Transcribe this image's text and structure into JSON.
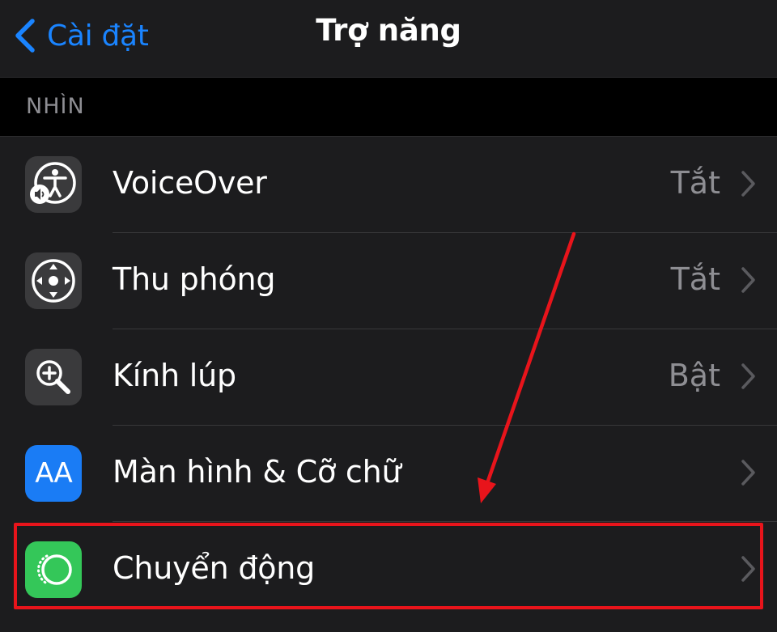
{
  "nav": {
    "back_label": "Cài đặt",
    "title": "Trợ năng"
  },
  "section": {
    "header": "NHÌN"
  },
  "rows": [
    {
      "label": "VoiceOver",
      "value": "Tắt",
      "icon": "voiceover-icon",
      "icon_bg": "#3a3a3c"
    },
    {
      "label": "Thu phóng",
      "value": "Tắt",
      "icon": "zoom-icon",
      "icon_bg": "#3a3a3c"
    },
    {
      "label": "Kính lúp",
      "value": "Bật",
      "icon": "magnifier-icon",
      "icon_bg": "#3a3a3c"
    },
    {
      "label": "Màn hình & Cỡ chữ",
      "value": "",
      "icon": "display-text-size-icon",
      "icon_bg": "#1a7cf5",
      "icon_text": "AA"
    },
    {
      "label": "Chuyển động",
      "value": "",
      "icon": "motion-icon",
      "icon_bg": "#34c759"
    }
  ],
  "colors": {
    "accent": "#1a84ff",
    "annotation": "#e8141b"
  }
}
